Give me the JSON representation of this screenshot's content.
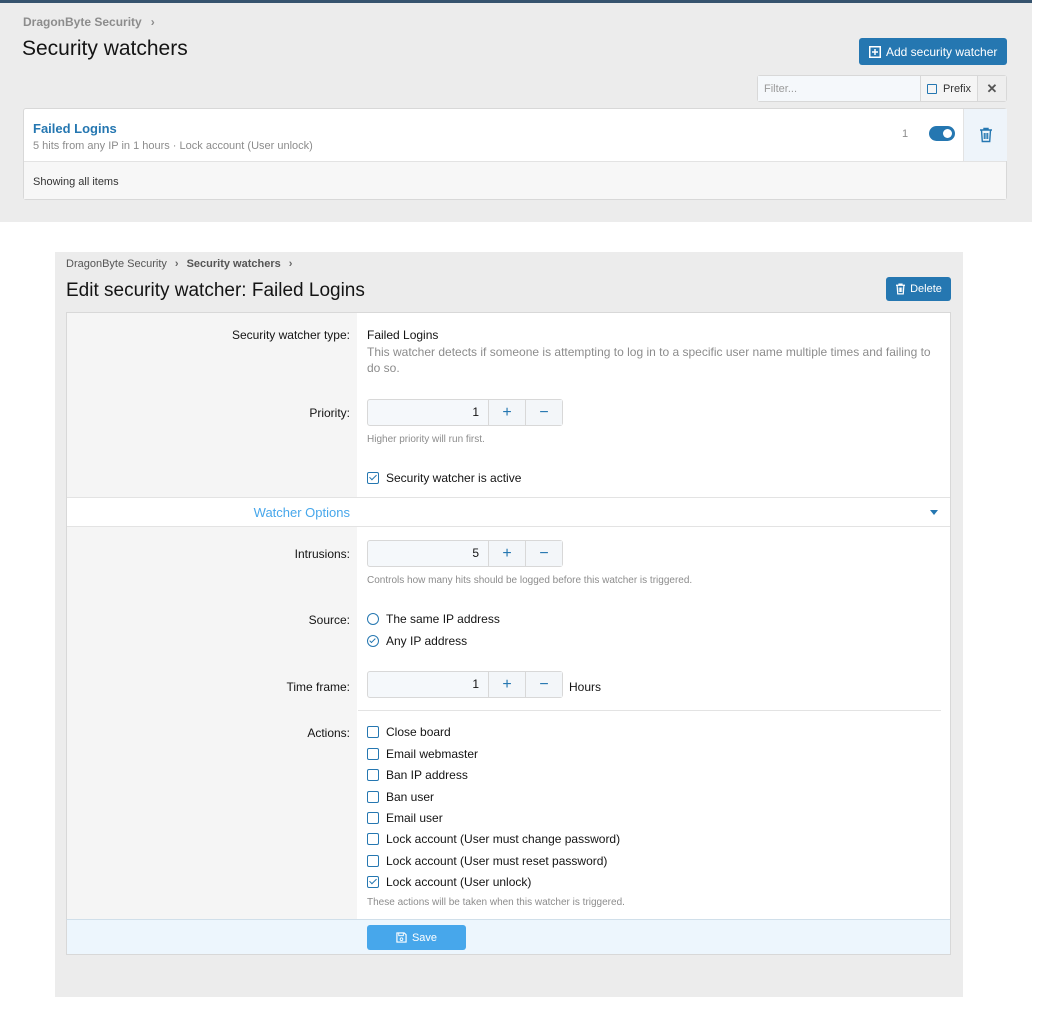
{
  "list_page": {
    "breadcrumb": "DragonByte Security",
    "breadcrumb_sep": "›",
    "title": "Security watchers",
    "add_button": "Add security watcher",
    "filter_placeholder": "Filter...",
    "prefix_label": "Prefix",
    "clear_label": "✕",
    "items": [
      {
        "title": "Failed Logins",
        "description": "5 hits from any IP in 1 hours · Lock account (User unlock)",
        "count": "1",
        "active": true
      }
    ],
    "footer": "Showing all items"
  },
  "edit_page": {
    "breadcrumb": [
      "DragonByte Security",
      "Security watchers"
    ],
    "breadcrumb_sep": "›",
    "title": "Edit security watcher: Failed Logins",
    "delete_button": "Delete",
    "type_label": "Security watcher type:",
    "type_value": "Failed Logins",
    "type_explain": "This watcher detects if someone is attempting to log in to a specific user name multiple times and failing to do so.",
    "priority_label": "Priority:",
    "priority_value": "1",
    "priority_hint": "Higher priority will run first.",
    "active_label": "Security watcher is active",
    "active_checked": true,
    "section_title": "Watcher Options",
    "intrusions_label": "Intrusions:",
    "intrusions_value": "5",
    "intrusions_hint": "Controls how many hits should be logged before this watcher is triggered.",
    "source_label": "Source:",
    "source_options": [
      {
        "label": "The same IP address",
        "selected": false
      },
      {
        "label": "Any IP address",
        "selected": true
      }
    ],
    "timeframe_label": "Time frame:",
    "timeframe_value": "1",
    "timeframe_unit": "Hours",
    "actions_label": "Actions:",
    "actions": [
      {
        "label": "Close board",
        "checked": false
      },
      {
        "label": "Email webmaster",
        "checked": false
      },
      {
        "label": "Ban IP address",
        "checked": false
      },
      {
        "label": "Ban user",
        "checked": false
      },
      {
        "label": "Email user",
        "checked": false
      },
      {
        "label": "Lock account (User must change password)",
        "checked": false
      },
      {
        "label": "Lock account (User must reset password)",
        "checked": false
      },
      {
        "label": "Lock account (User unlock)",
        "checked": true
      }
    ],
    "actions_hint": "These actions will be taken when this watcher is triggered.",
    "save_button": "Save",
    "plus": "+",
    "minus": "−"
  },
  "colors": {
    "accent": "#2577b1",
    "accent_light": "#47a7eb",
    "muted_text": "#8c8c8c",
    "page_bg": "#ececec"
  },
  "icons": [
    "plus-square-icon",
    "trash-icon",
    "save-icon",
    "chevron-right-icon",
    "caret-down-icon"
  ]
}
